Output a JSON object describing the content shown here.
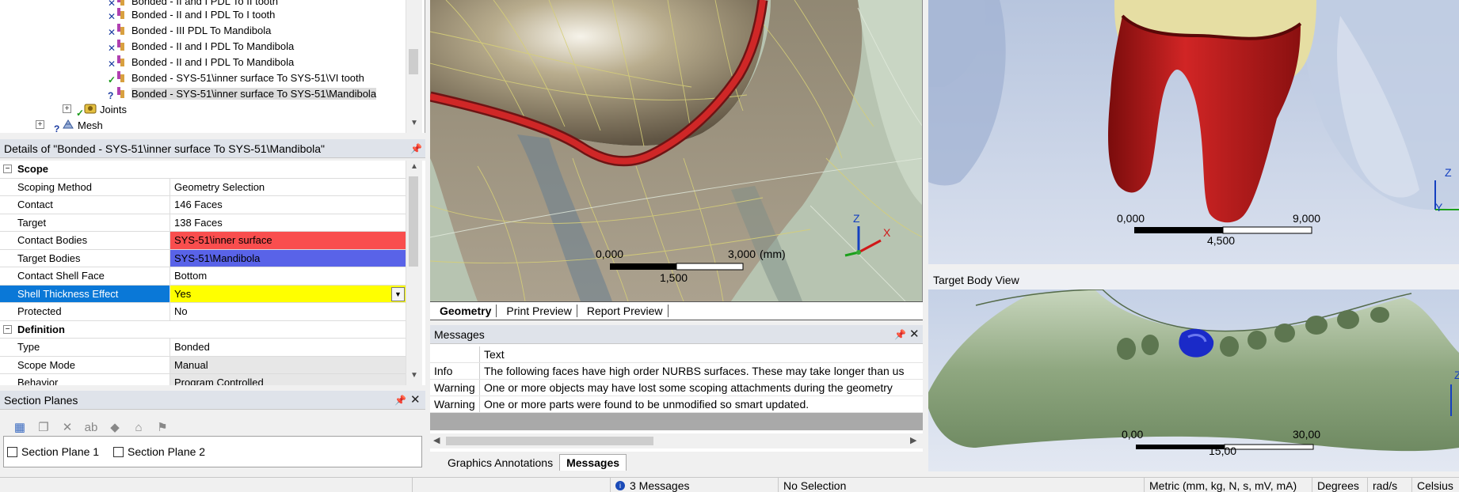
{
  "tree": {
    "items": [
      {
        "label": "Bonded - II and I PDL To II tooth",
        "mark": "x"
      },
      {
        "label": "Bonded - II and I PDL To I tooth",
        "mark": "x"
      },
      {
        "label": "Bonded - III PDL To Mandibola",
        "mark": "x"
      },
      {
        "label": "Bonded - II and I PDL To Mandibola",
        "mark": "x"
      },
      {
        "label": "Bonded - II and I PDL To Mandibola",
        "mark": "x"
      },
      {
        "label": "Bonded - SYS-51\\inner surface To SYS-51\\VI tooth",
        "mark": "check"
      },
      {
        "label": "Bonded - SYS-51\\inner surface To SYS-51\\Mandibola",
        "mark": "question"
      }
    ],
    "joints_label": "Joints",
    "mesh_label": "Mesh"
  },
  "details": {
    "title": "Details of \"Bonded - SYS-51\\inner surface To SYS-51\\Mandibola\"",
    "groups": {
      "scope": "Scope",
      "definition": "Definition"
    },
    "rows": {
      "scoping_method": {
        "k": "Scoping Method",
        "v": "Geometry Selection"
      },
      "contact": {
        "k": "Contact",
        "v": "146 Faces"
      },
      "target": {
        "k": "Target",
        "v": "138 Faces"
      },
      "contact_bodies": {
        "k": "Contact Bodies",
        "v": "SYS-51\\inner surface"
      },
      "target_bodies": {
        "k": "Target Bodies",
        "v": "SYS-51\\Mandibola"
      },
      "contact_shell_face": {
        "k": "Contact Shell Face",
        "v": "Bottom"
      },
      "shell_thickness": {
        "k": "Shell Thickness Effect",
        "v": "Yes"
      },
      "protected": {
        "k": "Protected",
        "v": "No"
      },
      "type": {
        "k": "Type",
        "v": "Bonded"
      },
      "scope_mode": {
        "k": "Scope Mode",
        "v": "Manual"
      },
      "behavior": {
        "k": "Behavior",
        "v": "Program Controlled"
      }
    }
  },
  "section_planes": {
    "title": "Section Planes",
    "items": [
      "Section Plane 1",
      "Section Plane 2"
    ]
  },
  "geometry_view": {
    "scale": {
      "left": "0,000",
      "right": "3,000",
      "unit": "(mm)",
      "mid": "1,500"
    },
    "tabs": [
      "Geometry",
      "Print Preview",
      "Report Preview"
    ],
    "active_tab": "Geometry"
  },
  "messages": {
    "title": "Messages",
    "header_text": "Text",
    "rows": [
      {
        "type": "Info",
        "text": "The following faces have high order NURBS surfaces. These may take longer than us"
      },
      {
        "type": "Warning",
        "text": "One or more objects may have lost some scoping attachments during the geometry"
      },
      {
        "type": "Warning",
        "text": "One or more parts were found to be unmodified so smart updated."
      }
    ],
    "bottom_tabs": [
      "Graphics Annotations",
      "Messages"
    ]
  },
  "top_right_view": {
    "scale": {
      "left": "0,000",
      "right": "9,000",
      "mid": "4,500"
    }
  },
  "target_body_view": {
    "title": "Target Body View",
    "scale": {
      "left": "0,00",
      "right": "30,00",
      "mid": "15,00"
    }
  },
  "status": {
    "messages": "3 Messages",
    "selection": "No Selection",
    "units": "Metric (mm, kg, N, s, mV, mA)",
    "angle": "Degrees",
    "angular_velocity": "rad/s",
    "temperature": "Celsius"
  },
  "axis": {
    "z": "Z",
    "x": "X",
    "y": "Y"
  },
  "colors": {
    "contact_red": "#f94e4e",
    "target_blue": "#5963e8",
    "highlight_yellow": "#ffff00",
    "selection_blue": "#0a78d7"
  }
}
